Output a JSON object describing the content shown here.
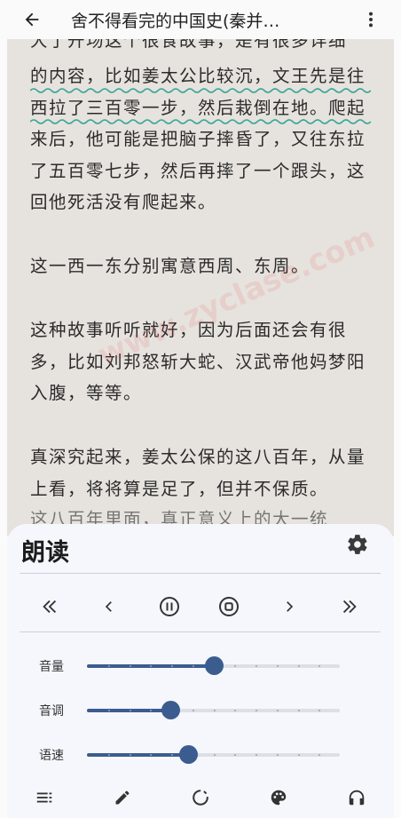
{
  "appbar": {
    "title": "舍不得看完的中国史(秦并…"
  },
  "reader": {
    "partial_top_line": "大了开场这个很食故事，是有很多详细",
    "paragraphs": [
      "的内容，比如姜太公比较沉，文王先是往西拉了三百零一步，然后栽倒在地。爬起来后，他可能是把脑子摔昏了，又往东拉了五百零七步，然后再摔了一个跟头，这回他死活没有爬起来。",
      "这一西一东分别寓意西周、东周。",
      "这种故事听听就好，因为后面还会有很多，比如刘邦怒斩大蛇、汉武帝他妈梦阳入腹，等等。",
      "真深究起来，姜太公保的这八百年，从量上看，将将算是足了，但并不保质。"
    ],
    "partial_bottom_line": "这八百年里面，真正意义上的大一统",
    "watermark": "www.zyclase.com"
  },
  "tts_panel": {
    "title": "朗读",
    "controls": [
      {
        "name": "prev-chapter-button",
        "icon": "double-chevron-left-icon"
      },
      {
        "name": "prev-paragraph-button",
        "icon": "chevron-left-icon"
      },
      {
        "name": "pause-button",
        "icon": "pause-circle-icon"
      },
      {
        "name": "stop-button",
        "icon": "stop-circle-icon"
      },
      {
        "name": "next-paragraph-button",
        "icon": "chevron-right-icon"
      },
      {
        "name": "next-chapter-button",
        "icon": "double-chevron-right-icon"
      }
    ],
    "sliders": [
      {
        "label": "音量",
        "value": 0.5
      },
      {
        "label": "音调",
        "value": 0.33
      },
      {
        "label": "语速",
        "value": 0.4
      }
    ],
    "bottom_icons": [
      "menu-list-icon",
      "pencil-icon",
      "timer-icon",
      "palette-icon",
      "headphones-icon"
    ]
  },
  "colors": {
    "accent": "#3b5c8f",
    "page_bg": "#e6e3de",
    "squiggle": "#3fa79a"
  }
}
